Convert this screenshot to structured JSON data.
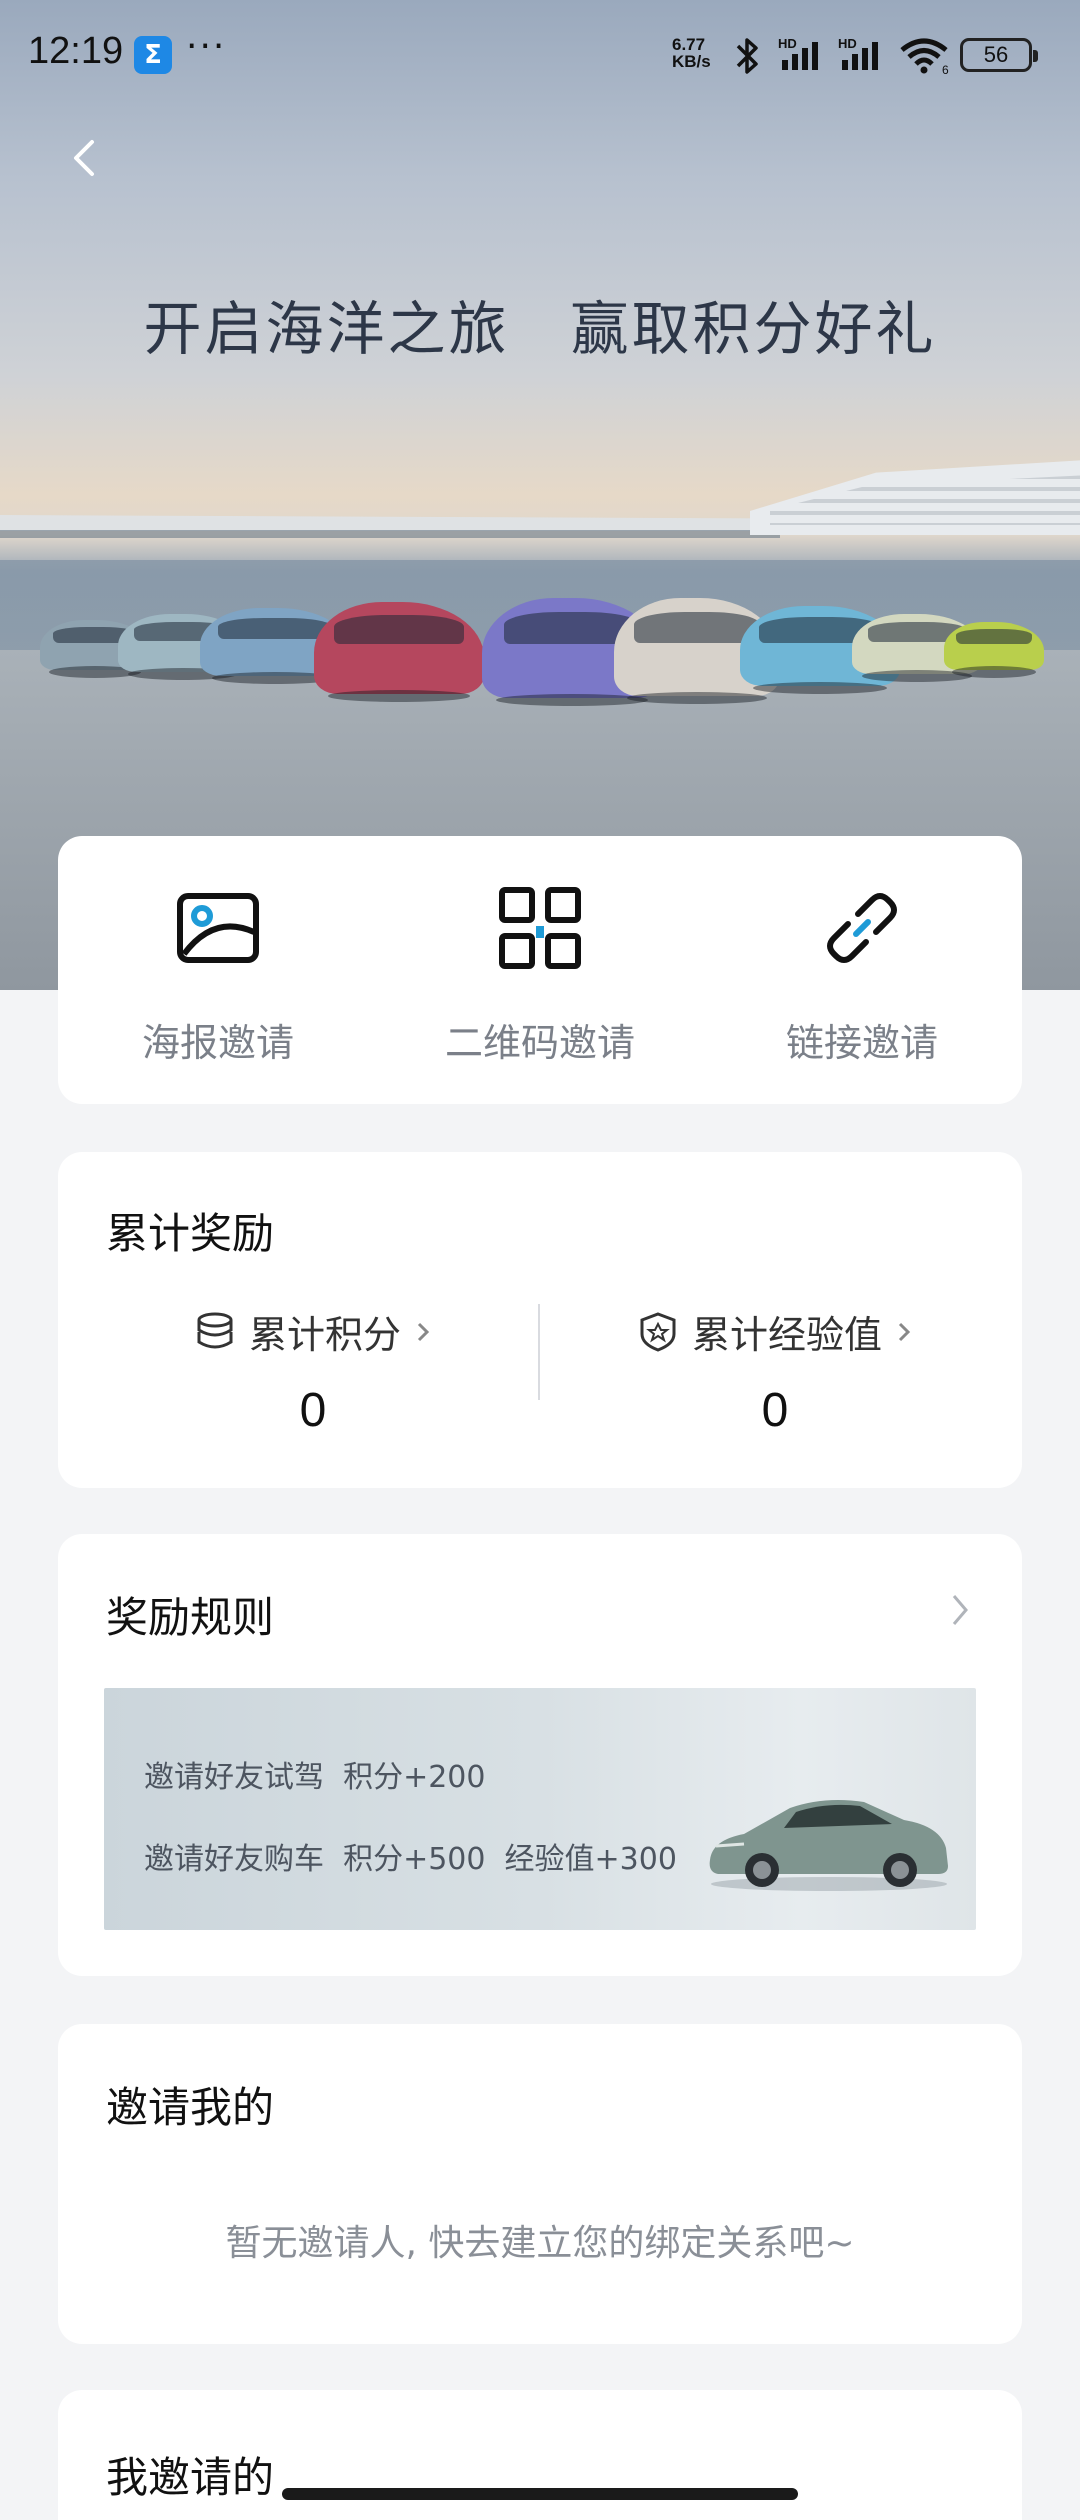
{
  "status_bar": {
    "time": "12:19",
    "app_badge": "Σ",
    "more": "···",
    "net_speed_value": "6.77",
    "net_speed_unit": "KB/s",
    "signal1_label": "HD",
    "signal2_label": "HD",
    "wifi_label": "6",
    "battery": "56"
  },
  "hero": {
    "title": "开启海洋之旅　赢取积分好礼"
  },
  "invite_options": [
    {
      "label": "海报邀请",
      "icon": "poster-image-icon"
    },
    {
      "label": "二维码邀请",
      "icon": "qr-code-icon"
    },
    {
      "label": "链接邀请",
      "icon": "link-icon"
    }
  ],
  "rewards": {
    "title": "累计奖励",
    "points_label": "累计积分",
    "points_value": "0",
    "exp_label": "累计经验值",
    "exp_value": "0"
  },
  "rules": {
    "title": "奖励规则",
    "line1": "邀请好友试驾  积分+200",
    "line2": "邀请好友购车  积分+500  经验值+300"
  },
  "my_inviter": {
    "title": "邀请我的",
    "empty_text": "暂无邀请人, 快去建立您的绑定关系吧~"
  },
  "my_invited": {
    "title": "我邀请的"
  },
  "colors": {
    "accent": "#1e9bd7",
    "card_bg": "#ffffff",
    "page_bg": "#f3f4f6"
  }
}
